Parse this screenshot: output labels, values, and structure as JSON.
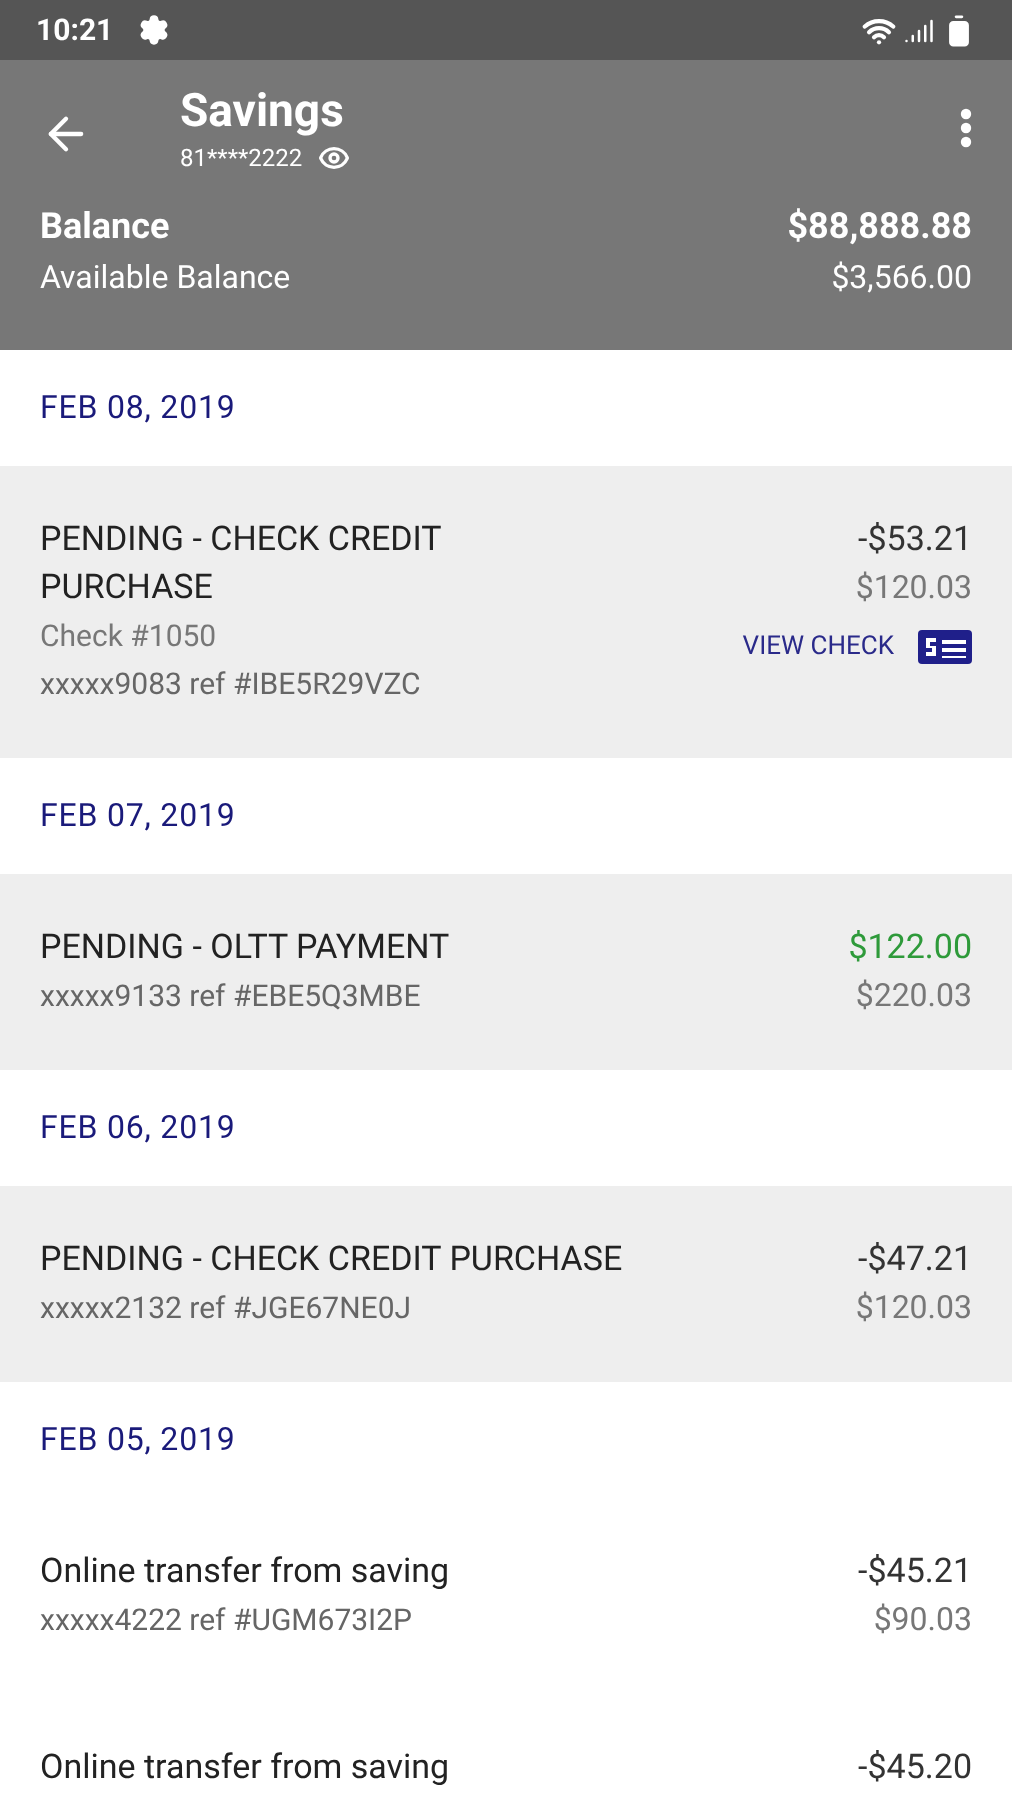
{
  "status_bar": {
    "time": "10:21"
  },
  "header": {
    "title": "Savings",
    "account_number": "81****2222",
    "balance_label": "Balance",
    "balance": "$88,888.88",
    "available_label": "Available Balance",
    "available": "$3,566.00"
  },
  "sections": [
    {
      "date": "FEB 08, 2019",
      "transactions": [
        {
          "title": "PENDING - CHECK CREDIT PURCHASE",
          "check_number": "Check #1050",
          "reference": "xxxxx9083 ref #IBE5R29VZC",
          "amount": "-$53.21",
          "balance": "$120.03",
          "credit": false,
          "highlighted": true,
          "view_check": "VIEW CHECK"
        }
      ]
    },
    {
      "date": "FEB 07, 2019",
      "transactions": [
        {
          "title": "PENDING - OLTT PAYMENT",
          "reference": "xxxxx9133 ref #EBE5Q3MBE",
          "amount": "$122.00",
          "balance": "$220.03",
          "credit": true,
          "highlighted": true
        }
      ]
    },
    {
      "date": "FEB 06, 2019",
      "transactions": [
        {
          "title": "PENDING - CHECK CREDIT PURCHASE",
          "reference": "xxxxx2132 ref #JGE67NE0J",
          "amount": "-$47.21",
          "balance": "$120.03",
          "credit": false,
          "highlighted": true
        }
      ]
    },
    {
      "date": "FEB 05, 2019",
      "transactions": [
        {
          "title": "Online transfer from saving",
          "reference": "xxxxx4222 ref #UGM673I2P",
          "amount": "-$45.21",
          "balance": "$90.03",
          "credit": false,
          "highlighted": false
        },
        {
          "title": "Online transfer from saving",
          "amount": "-$45.20",
          "credit": false,
          "highlighted": false
        }
      ]
    }
  ]
}
